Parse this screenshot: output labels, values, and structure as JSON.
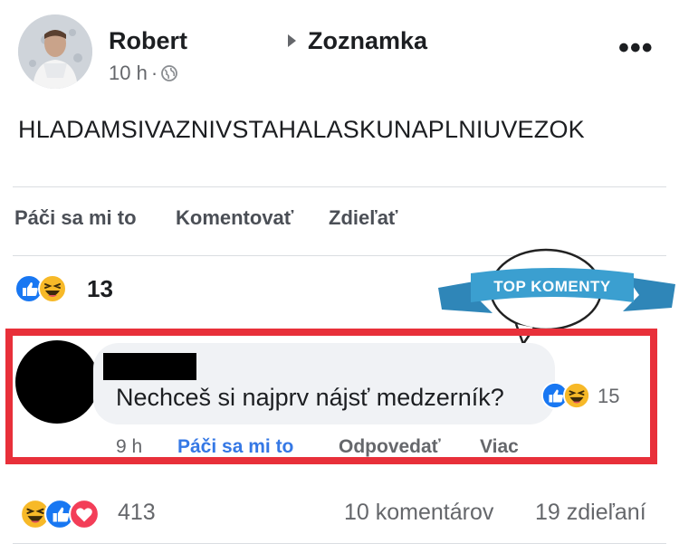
{
  "post": {
    "author": "Robert",
    "group": "Zoznamka",
    "time": "10 h",
    "separator": "·",
    "text": "HLADAMSIVAZNIVSTAHALASKUNAPLNIUVEZOK",
    "more_label": "•••"
  },
  "actions": {
    "like": "Páči sa mi to",
    "comment": "Komentovať",
    "share": "Zdieľať"
  },
  "reactions": {
    "count": "13",
    "icons": [
      "like-icon",
      "haha-icon"
    ]
  },
  "badge": {
    "label": "TOP KOMENTY",
    "color": "#3b9fd0"
  },
  "comment": {
    "text": "Nechceš si najprv nájsť medzerník?",
    "reaction_count": "15",
    "time": "9 h",
    "like": "Páči sa mi to",
    "reply": "Odpovedať",
    "more": "Viac"
  },
  "footer": {
    "reaction_count": "413",
    "comments": "10 komentárov",
    "shares": "19 zdieľaní",
    "icons": [
      "haha-icon",
      "like-icon",
      "love-icon"
    ]
  },
  "colors": {
    "highlight": "#e8303a",
    "link": "#3578e5",
    "like": "#1877f2",
    "love": "#f33e58",
    "haha": "#f7b928"
  }
}
